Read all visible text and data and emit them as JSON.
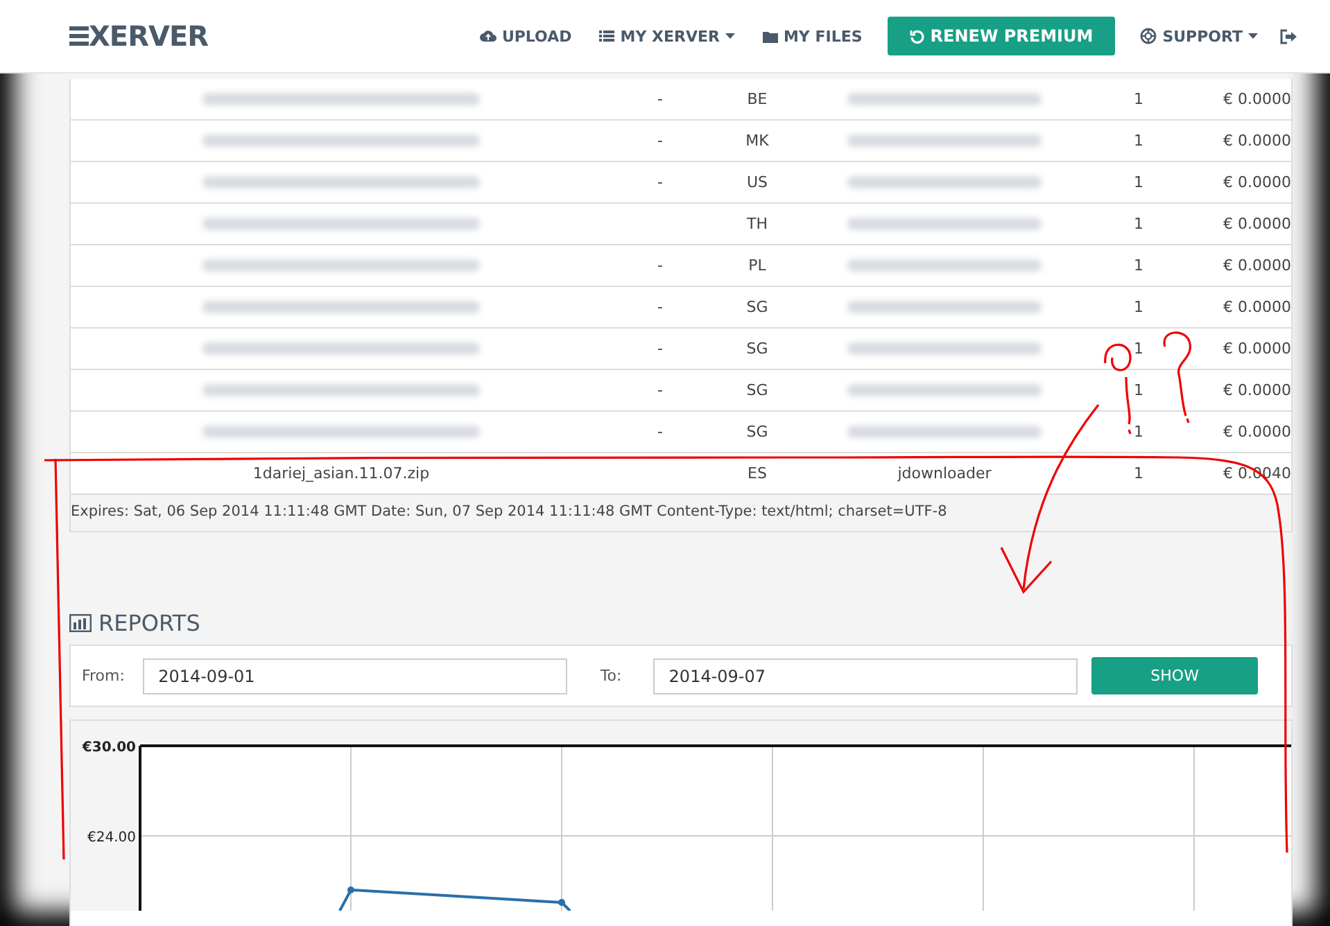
{
  "nav": {
    "logo": "XERVER",
    "items": [
      {
        "label": "UPLOAD",
        "kind": "link",
        "dropdown": false
      },
      {
        "label": "MY XERVER",
        "kind": "link",
        "dropdown": true
      },
      {
        "label": "MY FILES",
        "kind": "link",
        "dropdown": false
      },
      {
        "label": "RENEW PREMIUM",
        "kind": "primary",
        "dropdown": false
      },
      {
        "label": "SUPPORT",
        "kind": "link",
        "dropdown": true
      },
      {
        "kind": "icon"
      }
    ]
  },
  "downloads_table": {
    "rows": [
      {
        "dash": "-",
        "country": "BE",
        "count": "1",
        "amount": "€ 0.0000"
      },
      {
        "dash": "-",
        "country": "MK",
        "count": "1",
        "amount": "€ 0.0000"
      },
      {
        "dash": "-",
        "country": "US",
        "count": "1",
        "amount": "€ 0.0000"
      },
      {
        "country": "TH",
        "count": "1",
        "amount": "€ 0.0000"
      },
      {
        "dash": "-",
        "country": "PL",
        "count": "1",
        "amount": "€ 0.0000"
      },
      {
        "dash": "-",
        "country": "SG",
        "count": "1",
        "amount": "€ 0.0000"
      },
      {
        "dash": "-",
        "country": "SG",
        "count": "1",
        "amount": "€ 0.0000"
      },
      {
        "dash": "-",
        "country": "SG",
        "count": "1",
        "amount": "€ 0.0000"
      },
      {
        "dash": "-",
        "country": "SG",
        "count": "1",
        "amount": "€ 0.0000"
      },
      {
        "file": "1dariej_asian.11.07.zip",
        "country": "ES",
        "referrer": "jdownloader",
        "count": "1",
        "amount": "€ 0.0040"
      }
    ],
    "footer_text": "Expires: Sat, 06 Sep 2014 11:11:48 GMT Date: Sun, 07 Sep 2014 11:11:48 GMT Content-Type: text/html; charset=UTF-8"
  },
  "reports": {
    "title": "REPORTS",
    "from_label": "From:",
    "from_value": "2014-09-01",
    "to_label": "To:",
    "to_value": "2014-09-07",
    "show_button": "SHOW",
    "chart": {
      "y_axis_labels": [
        "€30.00",
        "€24.00"
      ]
    }
  },
  "annotation": {
    "shown": true
  }
}
